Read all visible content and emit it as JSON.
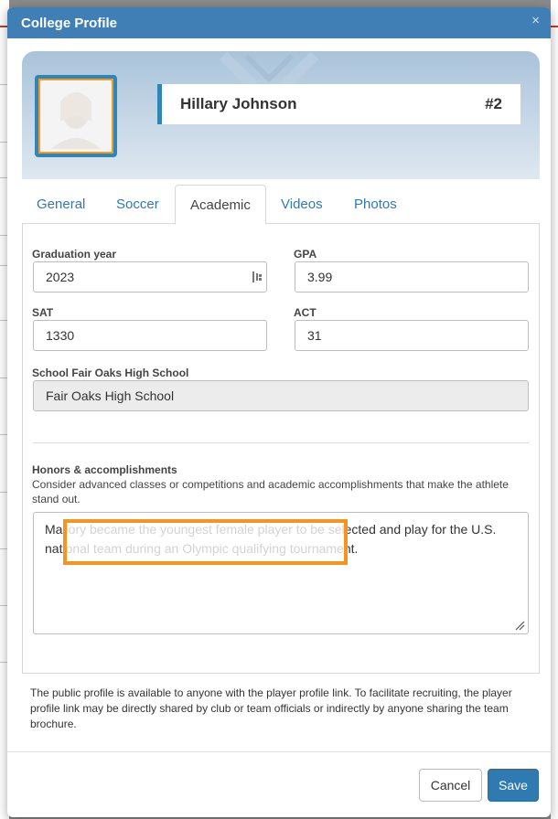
{
  "modal": {
    "title": "College Profile",
    "close_glyph": "×",
    "accent_color": "#3f7fb5",
    "highlight_color": "#f7941d"
  },
  "player": {
    "name": "Hillary Johnson",
    "number": "#2"
  },
  "tabs": [
    {
      "label": "General",
      "active": false
    },
    {
      "label": "Soccer",
      "active": false
    },
    {
      "label": "Academic",
      "active": true
    },
    {
      "label": "Videos",
      "active": false
    },
    {
      "label": "Photos",
      "active": false
    }
  ],
  "academic": {
    "graduation_year": {
      "label": "Graduation year",
      "value": "2023",
      "icon": "calendar-icon"
    },
    "gpa": {
      "label": "GPA",
      "value": "3.99"
    },
    "sat": {
      "label": "SAT",
      "value": "1330"
    },
    "act": {
      "label": "ACT",
      "value": "31"
    },
    "school": {
      "label": "School Fair Oaks High School",
      "value": "Fair Oaks High School"
    },
    "honors": {
      "label": "Honors & accomplishments",
      "helper": "Consider advanced classes or competitions and academic accomplishments that make the athlete stand out.",
      "value_line1": "Mallory became the youngest female player to be selected and play for the U.S.",
      "value_line2": "national team during an Olympic qualifying tournament."
    }
  },
  "notice": "The public profile is available to anyone with the player profile link. To facilitate recruiting, the player profile link may be directly shared by club or team officials or indirectly by anyone sharing the team brochure.",
  "buttons": {
    "cancel": "Cancel",
    "save": "Save"
  }
}
